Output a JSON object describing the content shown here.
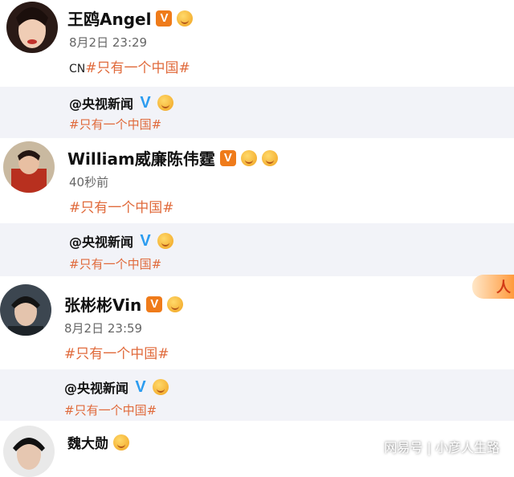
{
  "posts": [
    {
      "name": "王鸥Angel",
      "time": "8月2日 23:29",
      "prefix": "CN",
      "tag": "#只有一个中国#",
      "quote": {
        "name": "@央视新闻",
        "tag": "#只有一个中国#"
      }
    },
    {
      "name": "William威廉陈伟霆",
      "time": "40秒前",
      "tag": "#只有一个中国#",
      "quote": {
        "name": "@央视新闻",
        "tag": "#只有一个中国#"
      }
    },
    {
      "name": "张彬彬Vin",
      "time": "8月2日 23:59",
      "tag": "#只有一个中国#",
      "quote": {
        "name": "@央视新闻",
        "tag": "#只有一个中国#"
      }
    },
    {
      "name": "魏大勋"
    }
  ],
  "sticker_text": "人",
  "watermark": "网易号 | 小彦人生路",
  "colors": {
    "tag": "#e06a3b",
    "quote_bg": "#f2f3f8",
    "v_badge": "#ef7b1a",
    "blue_v": "#2b9cf0"
  }
}
